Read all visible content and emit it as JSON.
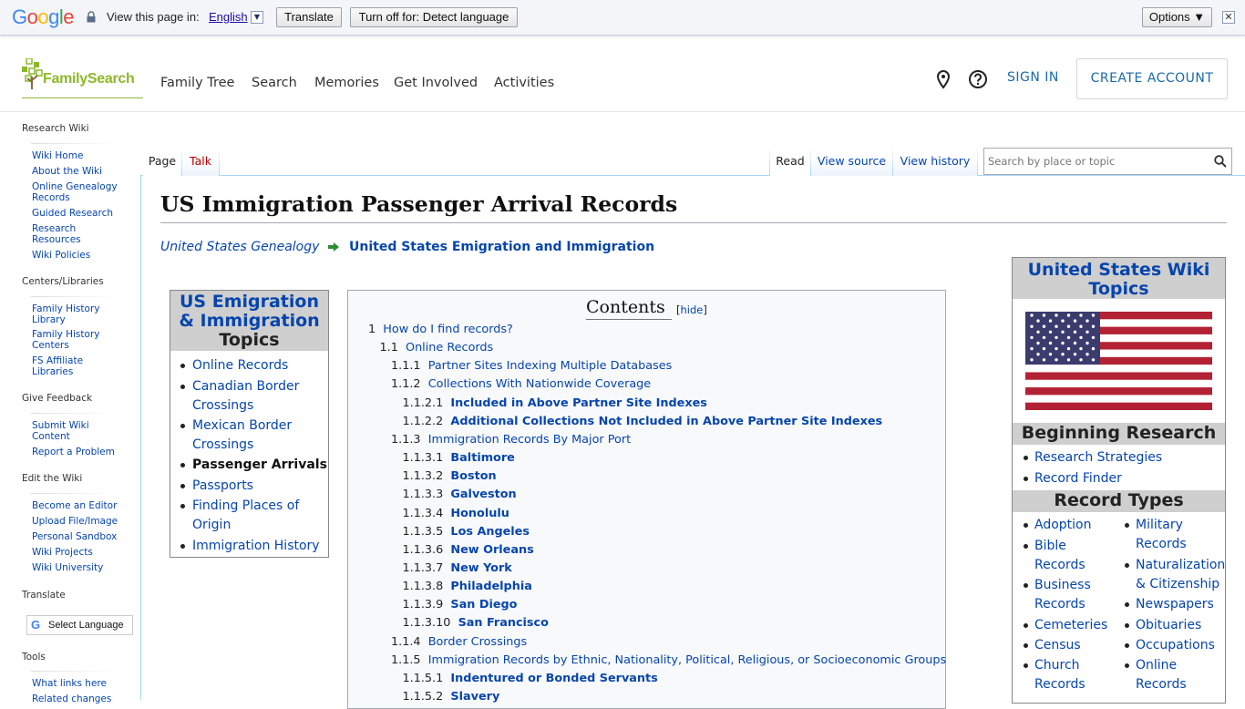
{
  "translate_bar": {
    "brand": "Google",
    "view_label": "View this page in:",
    "language": "English",
    "translate_btn": "Translate",
    "turnoff_btn": "Turn off for: Detect language",
    "options_btn": "Options ▼",
    "close": "✕"
  },
  "header": {
    "logo": "FamilySearch",
    "nav": [
      "Family Tree",
      "Search",
      "Memories",
      "Get Involved",
      "Activities"
    ],
    "sign_in": "SIGN IN",
    "create_account": "CREATE ACCOUNT",
    "icons": [
      "location-pin-icon",
      "help-icon"
    ]
  },
  "sidebar": {
    "sections": [
      {
        "heading": "Research Wiki",
        "links": [
          "Wiki Home",
          "About the Wiki",
          "Online Genealogy Records",
          "Guided Research",
          "Research Resources",
          "Wiki Policies"
        ]
      },
      {
        "heading": "Centers/Libraries",
        "links": [
          "Family History Library",
          "Family History Centers",
          "FS Affiliate Libraries"
        ]
      },
      {
        "heading": "Give Feedback",
        "links": [
          "Submit Wiki Content",
          "Report a Problem"
        ]
      },
      {
        "heading": "Edit the Wiki",
        "links": [
          "Become an Editor",
          "Upload File/Image",
          "Personal Sandbox",
          "Wiki Projects",
          "Wiki University"
        ]
      },
      {
        "heading": "Translate",
        "links": []
      },
      {
        "heading": "Tools",
        "links": [
          "What links here",
          "Related changes"
        ]
      }
    ],
    "select_language": "Select Language"
  },
  "tabs": {
    "page": "Page",
    "talk": "Talk",
    "read": "Read",
    "view_source": "View source",
    "view_history": "View history"
  },
  "search": {
    "placeholder": "Search by place or topic"
  },
  "page": {
    "title": "US Immigration Passenger Arrival Records",
    "breadcrumb_parent": "United States Genealogy",
    "breadcrumb_current": "United States Emigration and Immigration"
  },
  "topics_box": {
    "title": "US Emigration & Immigration",
    "subtitle": "Topics",
    "items": [
      "Online Records",
      "Canadian Border Crossings",
      "Mexican Border Crossings",
      "Passenger Arrivals",
      "Passports",
      "Finding Places of Origin",
      "Immigration History"
    ]
  },
  "toc": {
    "title": "Contents",
    "hide": "hide",
    "items": [
      {
        "num": "1",
        "text": "How do I find records?",
        "level": 0,
        "bold": false
      },
      {
        "num": "1.1",
        "text": "Online Records",
        "level": 1,
        "bold": false
      },
      {
        "num": "1.1.1",
        "text": "Partner Sites Indexing Multiple Databases",
        "level": 2,
        "bold": false
      },
      {
        "num": "1.1.2",
        "text": "Collections With Nationwide Coverage",
        "level": 2,
        "bold": false
      },
      {
        "num": "1.1.2.1",
        "text": "Included in Above Partner Site Indexes",
        "level": 3,
        "bold": true
      },
      {
        "num": "1.1.2.2",
        "text": "Additional Collections Not Included in Above Partner Site Indexes",
        "level": 3,
        "bold": true
      },
      {
        "num": "1.1.3",
        "text": "Immigration Records By Major Port",
        "level": 2,
        "bold": false
      },
      {
        "num": "1.1.3.1",
        "text": "Baltimore",
        "level": 3,
        "bold": true
      },
      {
        "num": "1.1.3.2",
        "text": "Boston",
        "level": 3,
        "bold": true
      },
      {
        "num": "1.1.3.3",
        "text": "Galveston",
        "level": 3,
        "bold": true
      },
      {
        "num": "1.1.3.4",
        "text": "Honolulu",
        "level": 3,
        "bold": true
      },
      {
        "num": "1.1.3.5",
        "text": "Los Angeles",
        "level": 3,
        "bold": true
      },
      {
        "num": "1.1.3.6",
        "text": "New Orleans",
        "level": 3,
        "bold": true
      },
      {
        "num": "1.1.3.7",
        "text": "New York",
        "level": 3,
        "bold": true
      },
      {
        "num": "1.1.3.8",
        "text": "Philadelphia",
        "level": 3,
        "bold": true
      },
      {
        "num": "1.1.3.9",
        "text": "San Diego",
        "level": 3,
        "bold": true
      },
      {
        "num": "1.1.3.10",
        "text": "San Francisco",
        "level": 3,
        "bold": true
      },
      {
        "num": "1.1.4",
        "text": "Border Crossings",
        "level": 2,
        "bold": false
      },
      {
        "num": "1.1.5",
        "text": "Immigration Records by Ethnic, Nationality, Political, Religious, or Socioeconomic Groups",
        "level": 2,
        "bold": false
      },
      {
        "num": "1.1.5.1",
        "text": "Indentured or Bonded Servants",
        "level": 3,
        "bold": true
      },
      {
        "num": "1.1.5.2",
        "text": "Slavery",
        "level": 3,
        "bold": true
      }
    ]
  },
  "infobox": {
    "title": "United States Wiki Topics",
    "beginning": "Beginning Research",
    "beginning_links": [
      "Research Strategies",
      "Record Finder"
    ],
    "record_types": "Record Types",
    "col1": [
      "Adoption",
      "Bible Records",
      "Business Records",
      "Cemeteries",
      "Census",
      "Church Records"
    ],
    "col2": [
      "Military Records",
      "Naturalization & Citizenship",
      "Newspapers",
      "Obituaries",
      "Occupations",
      "Online Records"
    ]
  },
  "colors": {
    "link": "#0645ad",
    "fs_green": "#8cb82b",
    "fs_blue": "#1a6aa8",
    "flag_red": "#b22234",
    "flag_blue": "#3c3b6e"
  }
}
